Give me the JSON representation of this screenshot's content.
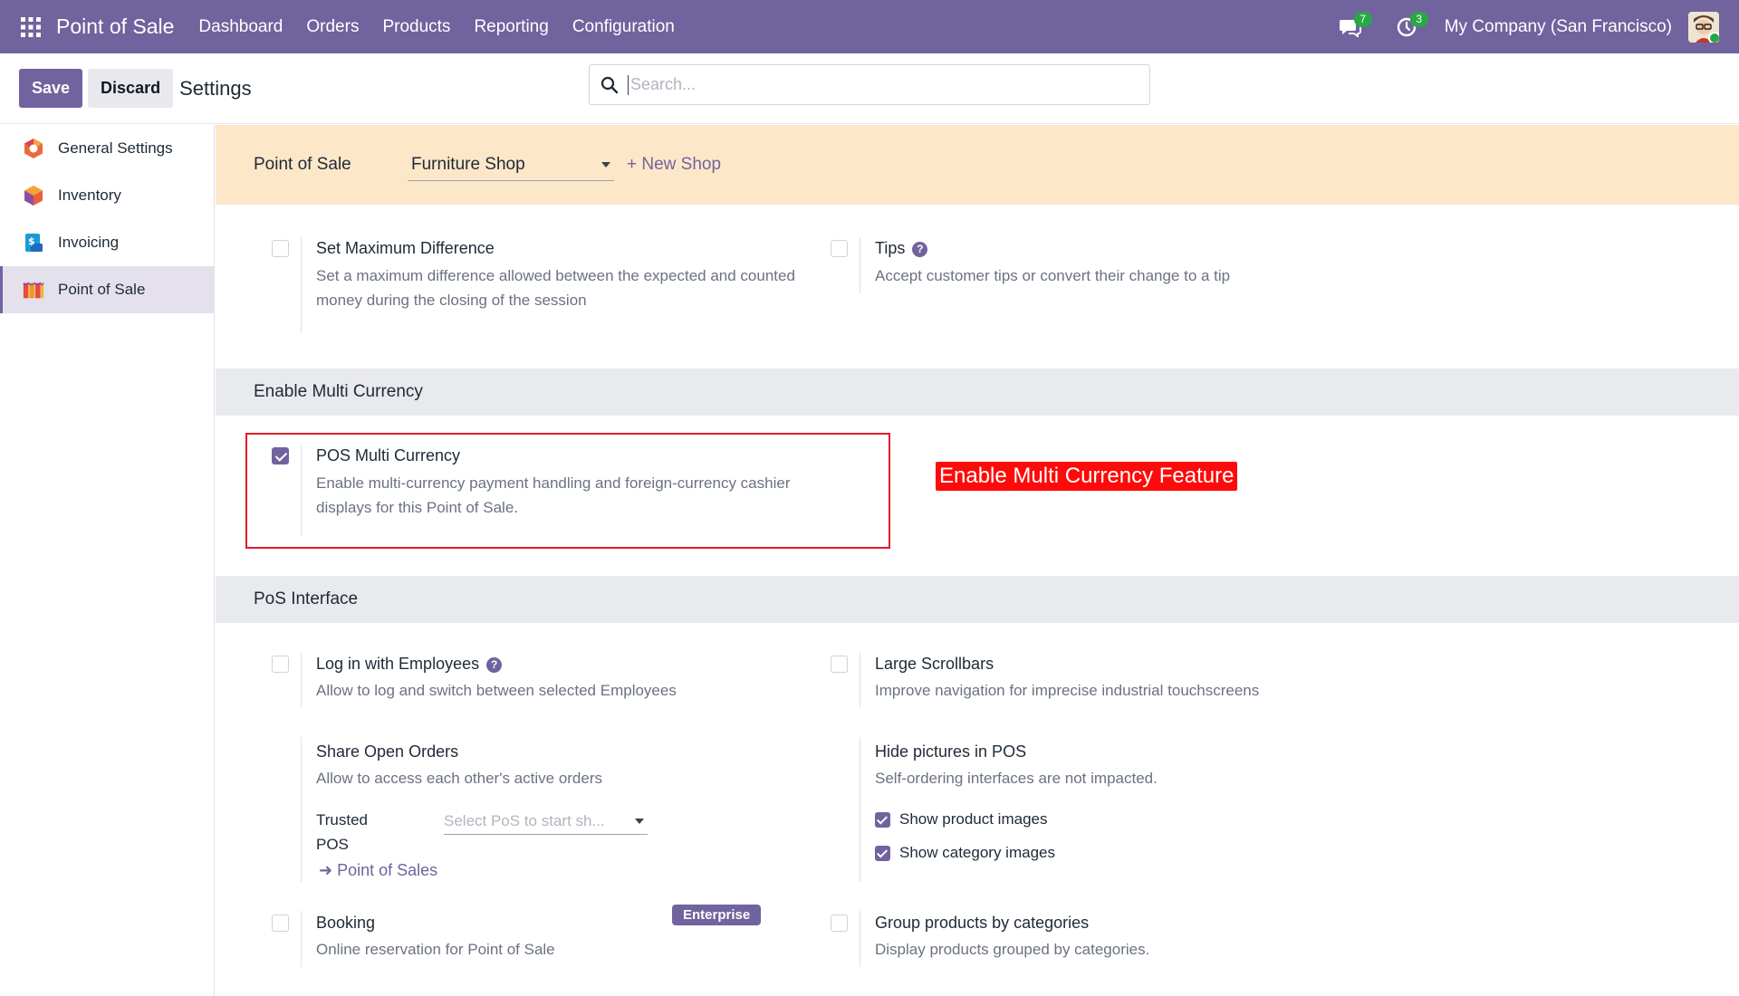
{
  "navbar": {
    "app_name": "Point of Sale",
    "menu": [
      "Dashboard",
      "Orders",
      "Products",
      "Reporting",
      "Configuration"
    ],
    "messages_count": "7",
    "activities_count": "3",
    "company": "My Company (San Francisco)"
  },
  "control_panel": {
    "save_label": "Save",
    "discard_label": "Discard",
    "title": "Settings",
    "search_placeholder": "Search..."
  },
  "sidebar": {
    "items": [
      {
        "label": "General Settings",
        "icon": "odoo-logo-icon"
      },
      {
        "label": "Inventory",
        "icon": "inventory-box-icon"
      },
      {
        "label": "Invoicing",
        "icon": "invoicing-icon"
      },
      {
        "label": "Point of Sale",
        "icon": "pos-shop-icon",
        "active": true
      }
    ]
  },
  "shop_bar": {
    "label": "Point of Sale",
    "selected_shop": "Furniture Shop",
    "new_shop": "+ New Shop"
  },
  "settings_top": {
    "max_difference": {
      "title": "Set Maximum Difference",
      "desc": "Set a maximum difference allowed between the expected and counted money during the closing of the session",
      "checked": false
    },
    "tips": {
      "title": "Tips",
      "desc": "Accept customer tips or convert their change to a tip",
      "checked": false
    }
  },
  "multi_currency": {
    "header": "Enable Multi Currency",
    "title": "POS Multi Currency",
    "desc": "Enable multi-currency payment handling and foreign-currency cashier displays for this Point of Sale.",
    "checked": true,
    "annotation": "Enable Multi Currency Feature"
  },
  "pos_interface": {
    "header": "PoS Interface",
    "login_employees": {
      "title": "Log in with Employees",
      "desc": "Allow to log and switch between selected Employees",
      "checked": false
    },
    "large_scrollbars": {
      "title": "Large Scrollbars",
      "desc": "Improve navigation for imprecise industrial touchscreens",
      "checked": false
    },
    "share_orders": {
      "title": "Share Open Orders",
      "desc": "Allow to access each other's active orders",
      "trusted_label": "Trusted POS",
      "trusted_placeholder": "Select PoS to start sh...",
      "link": "Point of Sales"
    },
    "hide_pictures": {
      "title": "Hide pictures in POS",
      "desc": "Self-ordering interfaces are not impacted.",
      "show_product_images": "Show product images",
      "show_category_images": "Show category images"
    },
    "booking": {
      "title": "Booking",
      "desc": "Online reservation for Point of Sale",
      "badge": "Enterprise",
      "checked": false
    },
    "group_products": {
      "title": "Group products by categories",
      "desc": "Display products grouped by categories.",
      "checked": false
    }
  },
  "colors": {
    "brand": "#71639e",
    "highlight": "#e11d2a",
    "annotation_bg": "#ff0a0a",
    "shop_bar_bg": "#fde7c9"
  }
}
